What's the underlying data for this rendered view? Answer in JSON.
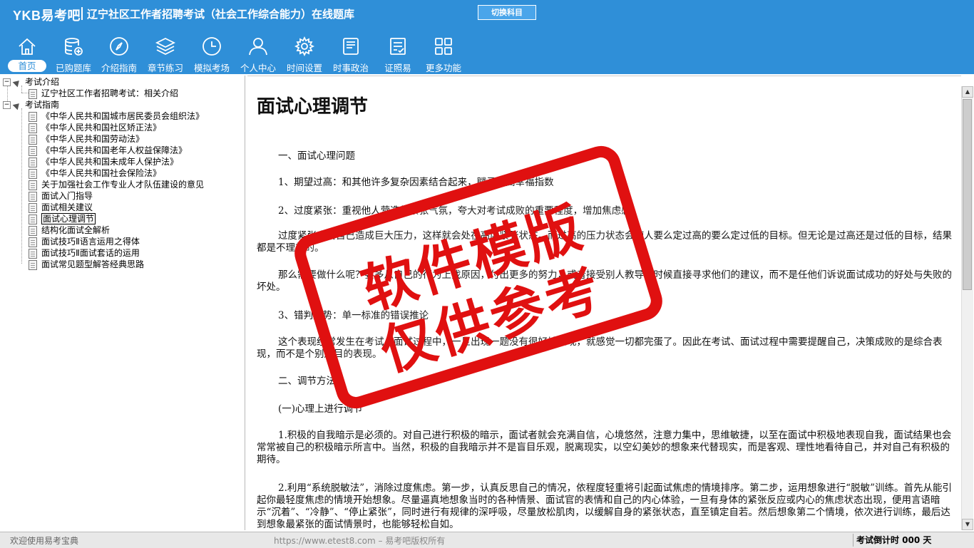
{
  "header": {
    "logo": "YKB易考吧",
    "title": "辽宁社区工作者招聘考试（社会工作综合能力）在线题库",
    "switch_label": "切换科目"
  },
  "nav": [
    {
      "label": "首页",
      "icon": "home-icon"
    },
    {
      "label": "已购题库",
      "icon": "database-icon"
    },
    {
      "label": "介绍指南",
      "icon": "compass-icon"
    },
    {
      "label": "章节练习",
      "icon": "layers-icon"
    },
    {
      "label": "模拟考场",
      "icon": "clock-icon"
    },
    {
      "label": "个人中心",
      "icon": "user-icon"
    },
    {
      "label": "时间设置",
      "icon": "gear-icon"
    },
    {
      "label": "时事政治",
      "icon": "book-icon"
    },
    {
      "label": "证照易",
      "icon": "checklist-icon"
    },
    {
      "label": "更多功能",
      "icon": "grid-icon"
    }
  ],
  "tree": {
    "group1": {
      "label": "考试介绍",
      "items": [
        "辽宁社区工作者招聘考试：相关介绍"
      ]
    },
    "group2": {
      "label": "考试指南",
      "items": [
        "《中华人民共和国城市居民委员会组织法》",
        "《中华人民共和国社区矫正法》",
        "《中华人民共和国劳动法》",
        "《中华人民共和国老年人权益保障法》",
        "《中华人民共和国未成年人保护法》",
        "《中华人民共和国社会保险法》",
        "关于加强社会工作专业人才队伍建设的意见",
        "面试入门指导",
        "面试相关建议",
        "面试心理调节",
        "结构化面试全解析",
        "面试技巧Ⅱ语言运用之得体",
        "面试技巧Ⅱ面试套话的运用",
        "面试常见题型解答经典思路"
      ]
    }
  },
  "article": {
    "title": "面试心理调节",
    "paragraphs": [
      "一、面试心理问题",
      "1、期望过高：和其他许多复杂因素结合起来，赋予过高幸福指数",
      "2、过度紧张：重视他人营造的紧张气氛，夸大对考试成败的重要程度，增加焦虑感。",
      "过度紧张会给自己造成巨大压力，这样就会处在高度紧张状态。而过高的压力状态会使人要么定过高的要么定过低的目标。但无论是过高还是过低的目标，结果都是不理想的。",
      "那么需要做什么呢？要多从自己的行为上找原因，付出更多的努力，或者接受别人教导的时候直接寻求他们的建议，而不是任他们诉说面试成功的好处与失败的坏处。",
      "3、错判形势：单一标准的错误推论",
      "这个表现经常发生在考试、面试过程中，一旦出现一题没有很好地表现，就感觉一切都完蛋了。因此在考试、面试过程中需要提醒自己，决策成败的是综合表现，而不是个别题目的表现。",
      "二、调节方法",
      "(一)心理上进行调节",
      "1.积极的自我暗示是必须的。对自己进行积极的暗示，面试者就会充满自信，心境悠然，注意力集中，思维敏捷，以至在面试中积极地表现自我，面试结果也会常常被自己的积极暗示所言中。当然，积极的自我暗示并不是盲目乐观，脱离现实，以空幻美妙的想象来代替现实，而是客观、理性地看待自己，并对自己有积极的期待。",
      "2.利用“系统脱敏法”，消除过度焦虑。第一步，认真反思自己的情况，依程度轻重将引起面试焦虑的情境排序。第二步，运用想象进行“脱敏”训练。首先从能引起你最轻度焦虑的情境开始想象。尽量逼真地想象当时的各种情景、面试官的表情和自己的内心体验，一旦有身体的紧张反应或内心的焦虑状态出现，便用言语暗示“沉着”、“冷静”、“停止紧张”，同时进行有规律的深呼吸，尽量放松肌肉，以缓解自身的紧张状态，直至镇定自若。然后想象第二个情境，依次进行训练，最后达到想象最紧张的面试情景时，也能够轻松自如。"
    ]
  },
  "watermark": {
    "line1": "软件模版",
    "line2": "仅供参考"
  },
  "status": {
    "left": "欢迎使用易考宝典",
    "middle": "https://www.etest8.com – 易考吧版权所有",
    "right": "考试倒计时 000 天"
  },
  "colors": {
    "header": "#2f8fd8",
    "stamp": "#e01010"
  }
}
